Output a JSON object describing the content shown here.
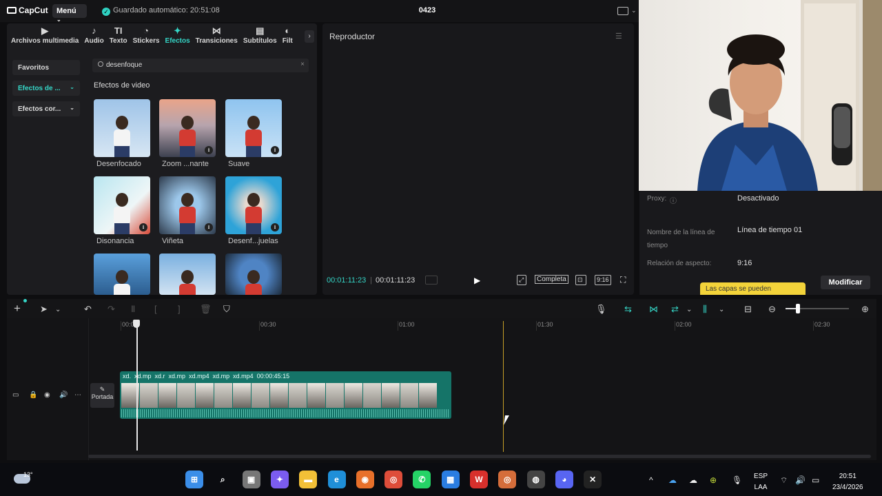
{
  "app": {
    "name": "CapCut",
    "menu": "Menú",
    "autosave": "Guardado automático: 20:51:08",
    "project": "0423"
  },
  "tabs": [
    {
      "label": "Archivos multimedia",
      "icon": "media-icon",
      "active": false
    },
    {
      "label": "Audio",
      "icon": "audio-icon",
      "active": false
    },
    {
      "label": "Texto",
      "icon": "text-icon",
      "active": false
    },
    {
      "label": "Stickers",
      "icon": "sticker-icon",
      "active": false
    },
    {
      "label": "Efectos",
      "icon": "effects-icon",
      "active": true
    },
    {
      "label": "Transiciones",
      "icon": "transitions-icon",
      "active": false
    },
    {
      "label": "Subtítulos",
      "icon": "subtitles-icon",
      "active": false
    },
    {
      "label": "Filt",
      "icon": "filters-icon",
      "active": false
    }
  ],
  "sidebar": [
    {
      "label": "Favoritos",
      "selected": false,
      "dropdown": false
    },
    {
      "label": "Efectos de ...",
      "selected": true,
      "dropdown": true
    },
    {
      "label": "Efectos cor...",
      "selected": false,
      "dropdown": true
    }
  ],
  "search": {
    "value": "desenfoque"
  },
  "section_title": "Efectos de video",
  "effects": [
    {
      "label": "Desenfocado",
      "download": false,
      "bg": "linear-gradient(180deg,#9fc4e8,#d7e6f3)"
    },
    {
      "label": "Zoom ...nante",
      "download": true,
      "bg": "linear-gradient(180deg,#e9a48a 0%,#b7a4ad 45%,#3d4150 100%)"
    },
    {
      "label": "Suave",
      "download": true,
      "bg": "linear-gradient(180deg,#8fc4ef,#c9e2f6)"
    },
    {
      "label": "Disonancia",
      "download": true,
      "bg": "linear-gradient(135deg,#b9e6f0,#eef6f7 60%,#d94c3a)"
    },
    {
      "label": "Viñeta",
      "download": true,
      "bg": "radial-gradient(circle,#9cc7ea 30%,#2d3a4b 100%)"
    },
    {
      "label": "Desenf...juelas",
      "download": true,
      "bg": "radial-gradient(circle,#e7d9cf 20%,#2ea3d8 70%)"
    },
    {
      "label": "",
      "download": false,
      "bg": "linear-gradient(180deg,#5aa0dc,#2c5d8f)"
    },
    {
      "label": "",
      "download": false,
      "bg": "linear-gradient(180deg,#7ab0e0,#d2e3f2)"
    },
    {
      "label": "",
      "download": false,
      "bg": "radial-gradient(circle,#4f84c4 40%,#1c2a3a 100%)"
    }
  ],
  "player": {
    "title": "Reproductor",
    "current": "00:01:11:23",
    "total": "00:01:11:23",
    "full": "Completa",
    "ratio": "9:16"
  },
  "properties": {
    "proxy_label": "Proxy:",
    "proxy_value": "Desactivado",
    "timeline_name_label": "Nombre de la línea de tiempo",
    "timeline_name_value": "Línea de tiempo 01",
    "aspect_label": "Relación de aspecto:",
    "aspect_value": "9:16",
    "modify": "Modificar",
    "tooltip": "Las capas se pueden"
  },
  "ruler": [
    "00:00",
    "00:30",
    "01:00",
    "01:30",
    "02:00",
    "02:30"
  ],
  "clips": [
    "xd.",
    "xd.mp",
    "xd.r",
    "xd.mp",
    "xd.mp4",
    "xd.mp",
    "xd.mp4",
    "00:00:45:15"
  ],
  "cover_label": "Portada",
  "taskbar": {
    "temp": "13°",
    "lang1": "ESP",
    "lang2": "LAA",
    "time": "20:51",
    "date": "23/4/2026"
  },
  "colors": {
    "accent": "#35d6c7",
    "clip": "#157468",
    "panel": "#1c1c1f"
  }
}
